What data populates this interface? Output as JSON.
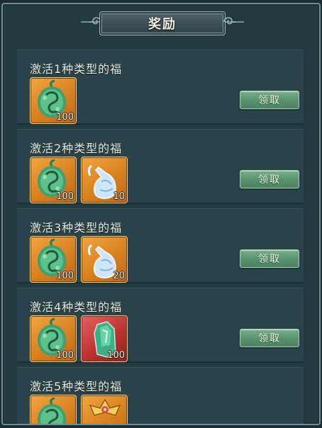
{
  "title": "奖励",
  "rows": [
    {
      "label": "激活1种类型的福",
      "claim": "领取",
      "items": [
        {
          "icon": "jade-pouch-icon",
          "qty": "100"
        }
      ]
    },
    {
      "label": "激活2种类型的福",
      "claim": "领取",
      "items": [
        {
          "icon": "jade-pouch-icon",
          "qty": "100"
        },
        {
          "icon": "water-gourd-icon",
          "qty": "10"
        }
      ]
    },
    {
      "label": "激活3种类型的福",
      "claim": "领取",
      "items": [
        {
          "icon": "jade-pouch-icon",
          "qty": "100"
        },
        {
          "icon": "water-gourd-icon",
          "qty": "20"
        }
      ]
    },
    {
      "label": "激活4种类型的福",
      "claim": "领取",
      "items": [
        {
          "icon": "jade-pouch-icon",
          "qty": "100"
        },
        {
          "icon": "jade-crystal-icon",
          "qty": "100"
        }
      ]
    },
    {
      "label": "激活5种类型的福",
      "claim": "",
      "items": [
        {
          "icon": "jade-pouch-icon",
          "qty": ""
        },
        {
          "icon": "golden-emblem-icon",
          "qty": ""
        }
      ]
    }
  ],
  "colors": {
    "panel": "#223a40",
    "row": "#2a434a",
    "claim_button": "#5a9470",
    "item_orange": "#e2902e",
    "item_red": "#c03a3a"
  }
}
